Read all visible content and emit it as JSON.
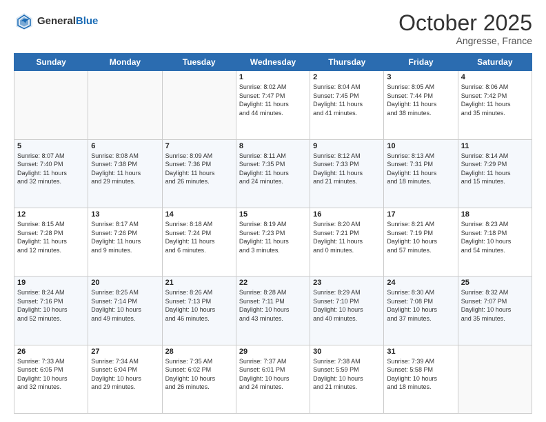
{
  "header": {
    "logo_general": "General",
    "logo_blue": "Blue",
    "month_title": "October 2025",
    "location": "Angresse, France"
  },
  "days_of_week": [
    "Sunday",
    "Monday",
    "Tuesday",
    "Wednesday",
    "Thursday",
    "Friday",
    "Saturday"
  ],
  "weeks": [
    [
      {
        "day": "",
        "info": ""
      },
      {
        "day": "",
        "info": ""
      },
      {
        "day": "",
        "info": ""
      },
      {
        "day": "1",
        "info": "Sunrise: 8:02 AM\nSunset: 7:47 PM\nDaylight: 11 hours\nand 44 minutes."
      },
      {
        "day": "2",
        "info": "Sunrise: 8:04 AM\nSunset: 7:45 PM\nDaylight: 11 hours\nand 41 minutes."
      },
      {
        "day": "3",
        "info": "Sunrise: 8:05 AM\nSunset: 7:44 PM\nDaylight: 11 hours\nand 38 minutes."
      },
      {
        "day": "4",
        "info": "Sunrise: 8:06 AM\nSunset: 7:42 PM\nDaylight: 11 hours\nand 35 minutes."
      }
    ],
    [
      {
        "day": "5",
        "info": "Sunrise: 8:07 AM\nSunset: 7:40 PM\nDaylight: 11 hours\nand 32 minutes."
      },
      {
        "day": "6",
        "info": "Sunrise: 8:08 AM\nSunset: 7:38 PM\nDaylight: 11 hours\nand 29 minutes."
      },
      {
        "day": "7",
        "info": "Sunrise: 8:09 AM\nSunset: 7:36 PM\nDaylight: 11 hours\nand 26 minutes."
      },
      {
        "day": "8",
        "info": "Sunrise: 8:11 AM\nSunset: 7:35 PM\nDaylight: 11 hours\nand 24 minutes."
      },
      {
        "day": "9",
        "info": "Sunrise: 8:12 AM\nSunset: 7:33 PM\nDaylight: 11 hours\nand 21 minutes."
      },
      {
        "day": "10",
        "info": "Sunrise: 8:13 AM\nSunset: 7:31 PM\nDaylight: 11 hours\nand 18 minutes."
      },
      {
        "day": "11",
        "info": "Sunrise: 8:14 AM\nSunset: 7:29 PM\nDaylight: 11 hours\nand 15 minutes."
      }
    ],
    [
      {
        "day": "12",
        "info": "Sunrise: 8:15 AM\nSunset: 7:28 PM\nDaylight: 11 hours\nand 12 minutes."
      },
      {
        "day": "13",
        "info": "Sunrise: 8:17 AM\nSunset: 7:26 PM\nDaylight: 11 hours\nand 9 minutes."
      },
      {
        "day": "14",
        "info": "Sunrise: 8:18 AM\nSunset: 7:24 PM\nDaylight: 11 hours\nand 6 minutes."
      },
      {
        "day": "15",
        "info": "Sunrise: 8:19 AM\nSunset: 7:23 PM\nDaylight: 11 hours\nand 3 minutes."
      },
      {
        "day": "16",
        "info": "Sunrise: 8:20 AM\nSunset: 7:21 PM\nDaylight: 11 hours\nand 0 minutes."
      },
      {
        "day": "17",
        "info": "Sunrise: 8:21 AM\nSunset: 7:19 PM\nDaylight: 10 hours\nand 57 minutes."
      },
      {
        "day": "18",
        "info": "Sunrise: 8:23 AM\nSunset: 7:18 PM\nDaylight: 10 hours\nand 54 minutes."
      }
    ],
    [
      {
        "day": "19",
        "info": "Sunrise: 8:24 AM\nSunset: 7:16 PM\nDaylight: 10 hours\nand 52 minutes."
      },
      {
        "day": "20",
        "info": "Sunrise: 8:25 AM\nSunset: 7:14 PM\nDaylight: 10 hours\nand 49 minutes."
      },
      {
        "day": "21",
        "info": "Sunrise: 8:26 AM\nSunset: 7:13 PM\nDaylight: 10 hours\nand 46 minutes."
      },
      {
        "day": "22",
        "info": "Sunrise: 8:28 AM\nSunset: 7:11 PM\nDaylight: 10 hours\nand 43 minutes."
      },
      {
        "day": "23",
        "info": "Sunrise: 8:29 AM\nSunset: 7:10 PM\nDaylight: 10 hours\nand 40 minutes."
      },
      {
        "day": "24",
        "info": "Sunrise: 8:30 AM\nSunset: 7:08 PM\nDaylight: 10 hours\nand 37 minutes."
      },
      {
        "day": "25",
        "info": "Sunrise: 8:32 AM\nSunset: 7:07 PM\nDaylight: 10 hours\nand 35 minutes."
      }
    ],
    [
      {
        "day": "26",
        "info": "Sunrise: 7:33 AM\nSunset: 6:05 PM\nDaylight: 10 hours\nand 32 minutes."
      },
      {
        "day": "27",
        "info": "Sunrise: 7:34 AM\nSunset: 6:04 PM\nDaylight: 10 hours\nand 29 minutes."
      },
      {
        "day": "28",
        "info": "Sunrise: 7:35 AM\nSunset: 6:02 PM\nDaylight: 10 hours\nand 26 minutes."
      },
      {
        "day": "29",
        "info": "Sunrise: 7:37 AM\nSunset: 6:01 PM\nDaylight: 10 hours\nand 24 minutes."
      },
      {
        "day": "30",
        "info": "Sunrise: 7:38 AM\nSunset: 5:59 PM\nDaylight: 10 hours\nand 21 minutes."
      },
      {
        "day": "31",
        "info": "Sunrise: 7:39 AM\nSunset: 5:58 PM\nDaylight: 10 hours\nand 18 minutes."
      },
      {
        "day": "",
        "info": ""
      }
    ]
  ]
}
